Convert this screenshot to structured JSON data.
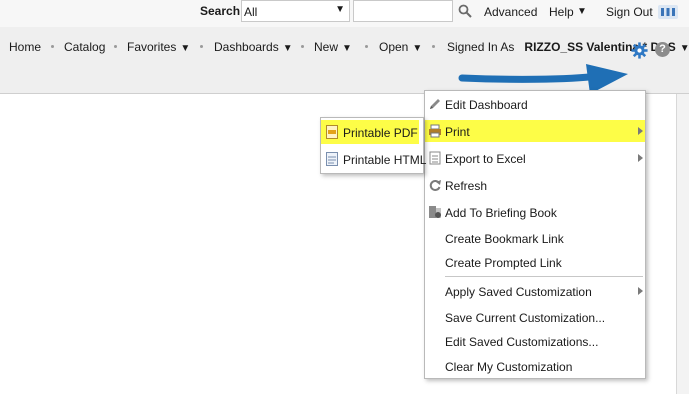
{
  "topbar": {
    "search_label": "Search",
    "search_scope": "All",
    "search_value": "",
    "advanced": "Advanced",
    "help": "Help",
    "sign_out": "Sign Out"
  },
  "nav": {
    "home": "Home",
    "catalog": "Catalog",
    "favorites": "Favorites",
    "dashboards": "Dashboards",
    "new": "New",
    "open": "Open",
    "signed_in_as": "Signed In As",
    "user": "RIZZO_SS Valentina * DAS"
  },
  "menu": {
    "items": [
      {
        "label": "Edit Dashboard",
        "icon": "pencil-icon"
      },
      {
        "label": "Print",
        "icon": "printer-icon",
        "has_submenu": true,
        "highlighted": true
      },
      {
        "label": "Export to Excel",
        "icon": "excel-icon",
        "has_submenu": true
      },
      {
        "label": "Refresh",
        "icon": "refresh-icon"
      },
      {
        "label": "Add To Briefing Book",
        "icon": "briefing-book-icon"
      },
      {
        "label": "Create Bookmark Link"
      },
      {
        "label": "Create Prompted Link"
      },
      {
        "label": "Apply Saved Customization",
        "has_submenu": true
      },
      {
        "label": "Save Current Customization..."
      },
      {
        "label": "Edit Saved Customizations..."
      },
      {
        "label": "Clear My Customization"
      }
    ]
  },
  "submenu": {
    "items": [
      {
        "label": "Printable PDF",
        "icon": "pdf-icon",
        "highlighted": true
      },
      {
        "label": "Printable HTML",
        "icon": "html-icon"
      }
    ]
  },
  "colors": {
    "highlight": "#fdfd47",
    "arrow": "#1f6fb5",
    "gear": "#2f78c4"
  }
}
